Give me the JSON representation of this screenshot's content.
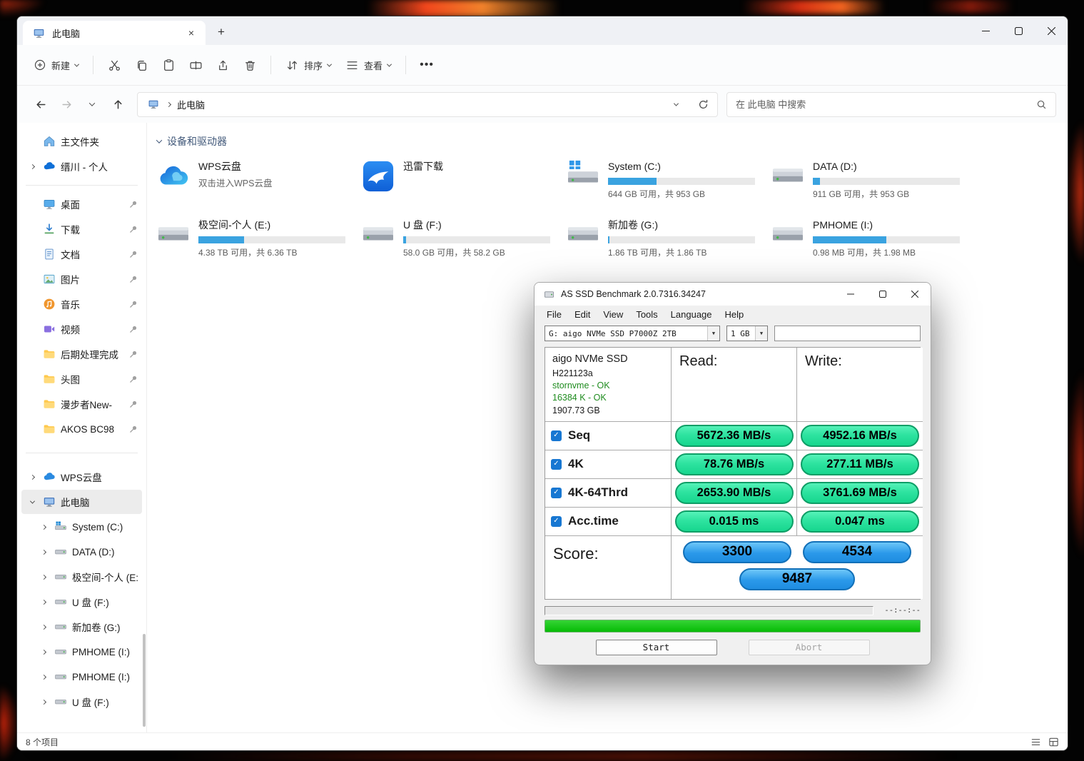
{
  "colors": {
    "drive_bar_fill": "#3aa3e0",
    "benchmark_value_green": "#2ee3a0",
    "benchmark_score_blue": "#2b99ea",
    "benchmark_progress_green": "#06bb06"
  },
  "explorer": {
    "tab_title": "此电脑",
    "toolbar": {
      "new": "新建",
      "sort": "排序",
      "view": "查看"
    },
    "address": {
      "breadcrumb": "此电脑",
      "search_placeholder": "在 此电脑 中搜索"
    },
    "sidebar": {
      "home": "主文件夹",
      "onedrive": "缙川 - 个人",
      "pinned": [
        "桌面",
        "下载",
        "文档",
        "图片",
        "音乐",
        "视频",
        "后期处理完成",
        "头图",
        "漫步者New-",
        "AKOS BC98"
      ],
      "wps": "WPS云盘",
      "this_pc": "此电脑",
      "drives": [
        "System (C:)",
        "DATA (D:)",
        "极空间-个人 (E:)",
        "U 盘 (F:)",
        "新加卷 (G:)",
        "PMHOME (I:)",
        "PMHOME (I:)",
        "U 盘 (F:)"
      ]
    },
    "content": {
      "section": "设备和驱动器",
      "wps": {
        "name": "WPS云盘",
        "desc": "双击进入WPS云盘"
      },
      "thunder": {
        "name": "迅雷下载"
      },
      "drives": [
        {
          "name": "System (C:)",
          "usage": "644 GB 可用，共 953 GB",
          "used_pct": 33
        },
        {
          "name": "DATA (D:)",
          "usage": "911 GB 可用，共 953 GB",
          "used_pct": 5
        },
        {
          "name": "极空间-个人 (E:)",
          "usage": "4.38 TB 可用，共 6.36 TB",
          "used_pct": 31
        },
        {
          "name": "U 盘 (F:)",
          "usage": "58.0 GB 可用，共 58.2 GB",
          "used_pct": 2
        },
        {
          "name": "新加卷 (G:)",
          "usage": "1.86 TB 可用，共 1.86 TB",
          "used_pct": 1
        },
        {
          "name": "PMHOME (I:)",
          "usage": "0.98 MB 可用，共 1.98 MB",
          "used_pct": 50
        }
      ]
    },
    "statusbar": {
      "items": "8 个项目"
    }
  },
  "benchmark": {
    "title": "AS SSD Benchmark 2.0.7316.34247",
    "menu": {
      "file": "File",
      "edit": "Edit",
      "view": "View",
      "tools": "Tools",
      "language": "Language",
      "help": "Help"
    },
    "drive_select": "G: aigo NVMe SSD P7000Z 2TB",
    "size_select": "1 GB",
    "info": {
      "line1": "aigo NVMe SSD",
      "line2": "H221123a",
      "line3": "stornvme - OK",
      "line4": "16384 K - OK",
      "line5": "1907.73 GB"
    },
    "read_header": "Read:",
    "write_header": "Write:",
    "rows": [
      {
        "label": "Seq",
        "read": "5672.36 MB/s",
        "write": "4952.16 MB/s"
      },
      {
        "label": "4K",
        "read": "78.76 MB/s",
        "write": "277.11 MB/s"
      },
      {
        "label": "4K-64Thrd",
        "read": "2653.90 MB/s",
        "write": "3761.69 MB/s"
      },
      {
        "label": "Acc.time",
        "read": "0.015 ms",
        "write": "0.047 ms"
      }
    ],
    "score_label": "Score:",
    "score_read": "3300",
    "score_write": "4534",
    "score_total": "9487",
    "elapsed": "--:--:--",
    "start_label": "Start",
    "abort_label": "Abort"
  }
}
